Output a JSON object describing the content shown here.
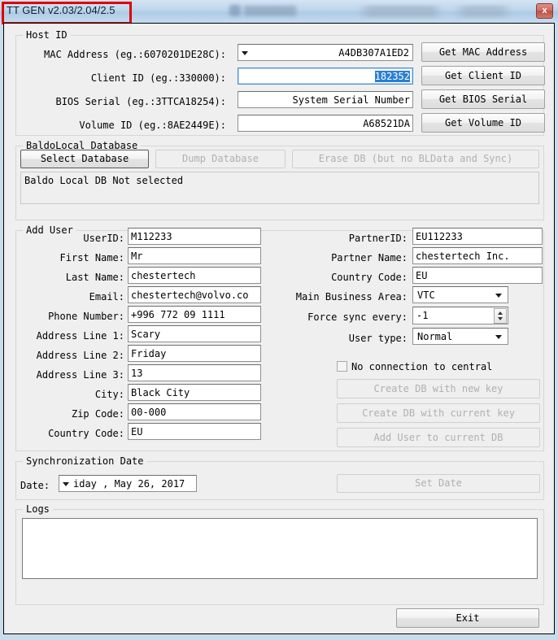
{
  "window": {
    "title": "TT GEN v2.03/2.04/2.5",
    "close_label": "x"
  },
  "annotation": {
    "color": "#e00000"
  },
  "host_id": {
    "group_title": "Host ID",
    "rows": [
      {
        "label": "MAC Address (eg.:6070201DE28C):",
        "value": "A4DB307A1ED2",
        "button": "Get MAC Address",
        "control": "combo"
      },
      {
        "label": "Client ID (eg.:330000):",
        "value": "182352",
        "button": "Get Client ID",
        "control": "text-focused"
      },
      {
        "label": "BIOS Serial (eg.:3TTCA18254):",
        "value": "System Serial Number",
        "button": "Get BIOS Serial",
        "control": "text"
      },
      {
        "label": "Volume ID (eg.:8AE2449E):",
        "value": "A68521DA",
        "button": "Get Volume ID",
        "control": "text"
      }
    ]
  },
  "database": {
    "group_title": "BaldoLocal Database",
    "select_button": "Select Database",
    "dump_button": "Dump Database",
    "erase_button": "Erase DB (but no BLData and Sync)",
    "status": "Baldo Local DB Not selected"
  },
  "add_user": {
    "group_title": "Add User",
    "left_fields": [
      {
        "label": "UserID:",
        "value": "M112233"
      },
      {
        "label": "First Name:",
        "value": "Mr"
      },
      {
        "label": "Last Name:",
        "value": "chestertech"
      },
      {
        "label": "Email:",
        "value": "chestertech@volvo.co"
      },
      {
        "label": "Phone Number:",
        "value": "+996 772 09 1111"
      },
      {
        "label": "Address Line 1:",
        "value": "Scary"
      },
      {
        "label": "Address Line 2:",
        "value": "Friday"
      },
      {
        "label": "Address Line 3:",
        "value": "13"
      },
      {
        "label": "City:",
        "value": "Black City"
      },
      {
        "label": "Zip Code:",
        "value": "00-000"
      },
      {
        "label": "Country Code:",
        "value": "EU"
      }
    ],
    "right_fields": [
      {
        "label": "PartnerID:",
        "value": "EU112233"
      },
      {
        "label": "Partner Name:",
        "value": "chestertech Inc."
      },
      {
        "label": "Country Code:",
        "value": "EU"
      }
    ],
    "business_area": {
      "label": "Main Business Area:",
      "value": "VTC"
    },
    "force_sync": {
      "label": "Force sync every:",
      "value": "-1"
    },
    "user_type": {
      "label": "User type:",
      "value": "Normal"
    },
    "no_connection": {
      "label": "No connection to central",
      "checked": false
    },
    "create_new_key_button": "Create DB with new key",
    "create_current_key_button": "Create DB with current key",
    "add_user_button": "Add User to current DB"
  },
  "sync": {
    "group_title": "Synchronization Date",
    "date_label": "Date:",
    "date_value": "iday ,    May   26, 2017",
    "set_date_button": "Set Date"
  },
  "logs": {
    "group_title": "Logs",
    "content": ""
  },
  "footer": {
    "exit_button": "Exit"
  }
}
